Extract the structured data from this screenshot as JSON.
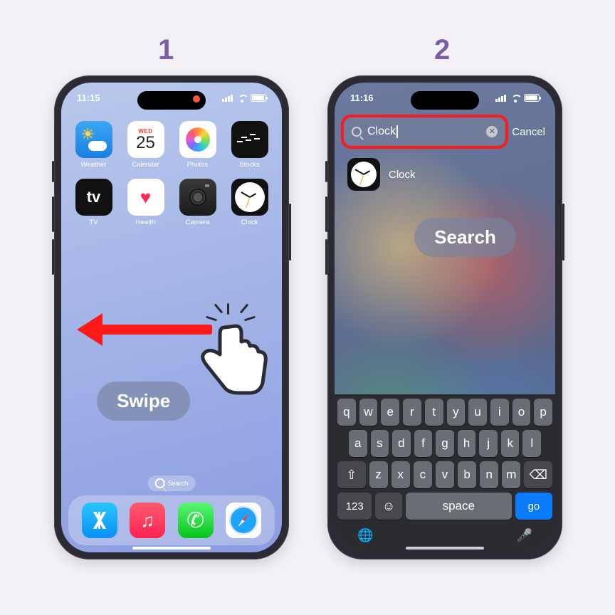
{
  "steps": {
    "one": "1",
    "two": "2"
  },
  "annotations": {
    "swipe": "Swipe",
    "search": "Search"
  },
  "phone1": {
    "time": "11:15",
    "apps": [
      {
        "label": "Weather"
      },
      {
        "label": "Calendar",
        "dow": "WED",
        "day": "25"
      },
      {
        "label": "Photos"
      },
      {
        "label": "Stocks"
      },
      {
        "label": "TV",
        "glyph": "tv"
      },
      {
        "label": "Health"
      },
      {
        "label": "Camera"
      },
      {
        "label": "Clock"
      }
    ],
    "search_pill": "Search",
    "dock": [
      "App Store",
      "Music",
      "Phone",
      "Safari"
    ]
  },
  "phone2": {
    "time": "11:16",
    "search_value": "Clock",
    "cancel": "Cancel",
    "result_label": "Clock",
    "keyboard": {
      "row1": [
        "q",
        "w",
        "e",
        "r",
        "t",
        "y",
        "u",
        "i",
        "o",
        "p"
      ],
      "row2": [
        "a",
        "s",
        "d",
        "f",
        "g",
        "h",
        "j",
        "k",
        "l"
      ],
      "row3": [
        "z",
        "x",
        "c",
        "v",
        "b",
        "n",
        "m"
      ],
      "numKey": "123",
      "space": "space",
      "go": "go"
    }
  }
}
